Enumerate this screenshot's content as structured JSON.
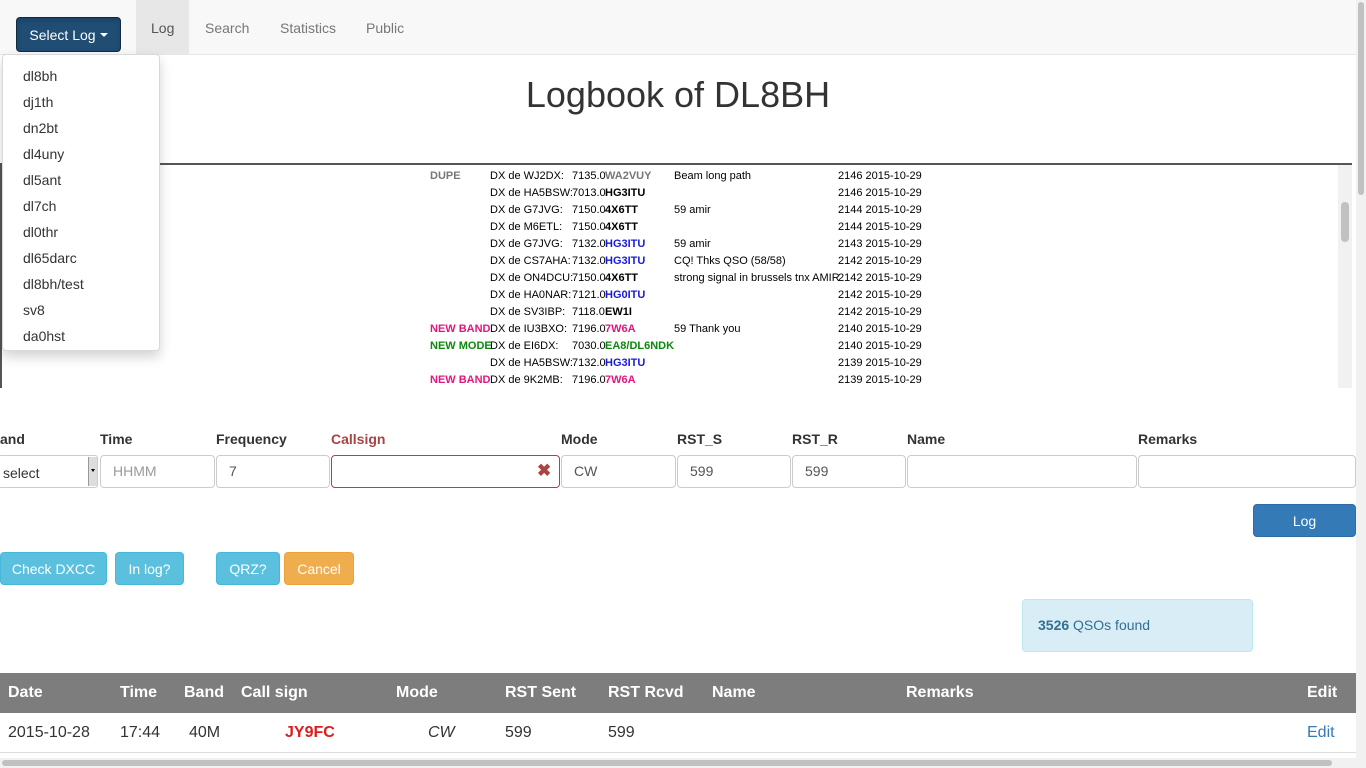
{
  "nav": {
    "select_log_label": "Select Log",
    "tabs": [
      {
        "label": "Log",
        "active": true
      },
      {
        "label": "Search",
        "active": false
      },
      {
        "label": "Statistics",
        "active": false
      },
      {
        "label": "Public",
        "active": false
      }
    ]
  },
  "dropdown": {
    "items": [
      "dl8bh",
      "dj1th",
      "dn2bt",
      "dl4uny",
      "dl5ant",
      "dl7ch",
      "dl0thr",
      "dl65darc",
      "dl8bh/test",
      "sv8",
      "da0hst"
    ]
  },
  "title": "Logbook of DL8BH",
  "cluster": {
    "rows": [
      {
        "flag": "DUPE",
        "flag_type": "dupe",
        "spotter": "DX de WJ2DX:",
        "freq": "7135.0",
        "call": "WA2VUY",
        "call_color": "#777777",
        "comment": "Beam long path",
        "time": "2146 2015-10-29"
      },
      {
        "flag": "",
        "flag_type": "",
        "spotter": "DX de HA5BSW:",
        "freq": "7013.0",
        "call": "HG3ITU",
        "call_color": "#000000",
        "comment": "",
        "time": "2146 2015-10-29"
      },
      {
        "flag": "",
        "flag_type": "",
        "spotter": "DX de G7JVG:",
        "freq": "7150.0",
        "call": "4X6TT",
        "call_color": "#000000",
        "comment": "59 amir",
        "time": "2144 2015-10-29"
      },
      {
        "flag": "",
        "flag_type": "",
        "spotter": "DX de M6ETL:",
        "freq": "7150.0",
        "call": "4X6TT",
        "call_color": "#000000",
        "comment": "",
        "time": "2144 2015-10-29"
      },
      {
        "flag": "",
        "flag_type": "",
        "spotter": "DX de G7JVG:",
        "freq": "7132.0",
        "call": "HG3ITU",
        "call_color": "#1a1ad6",
        "comment": "59 amir",
        "time": "2143 2015-10-29"
      },
      {
        "flag": "",
        "flag_type": "",
        "spotter": "DX de CS7AHA:",
        "freq": "7132.0",
        "call": "HG3ITU",
        "call_color": "#1a1ad6",
        "comment": "CQ! Thks QSO (58/58)",
        "time": "2142 2015-10-29"
      },
      {
        "flag": "",
        "flag_type": "",
        "spotter": "DX de ON4DCU:",
        "freq": "7150.0",
        "call": "4X6TT",
        "call_color": "#000000",
        "comment": "strong signal in brussels tnx AMIR",
        "time": "2142 2015-10-29"
      },
      {
        "flag": "",
        "flag_type": "",
        "spotter": "DX de HA0NAR:",
        "freq": "7121.0",
        "call": "HG0ITU",
        "call_color": "#1a1ad6",
        "comment": "",
        "time": "2142 2015-10-29"
      },
      {
        "flag": "",
        "flag_type": "",
        "spotter": "DX de SV3IBP:",
        "freq": "7118.0",
        "call": "EW1I",
        "call_color": "#000000",
        "comment": "",
        "time": "2142 2015-10-29"
      },
      {
        "flag": "NEW BAND",
        "flag_type": "newband",
        "spotter": "DX de IU3BXO:",
        "freq": "7196.0",
        "call": "7W6A",
        "call_color": "#e0177d",
        "comment": "59 Thank you",
        "time": "2140 2015-10-29"
      },
      {
        "flag": "NEW MODE",
        "flag_type": "newmode",
        "spotter": "DX de EI6DX:",
        "freq": "7030.0",
        "call": "EA8/DL6NDK",
        "call_color": "#0a8a0a",
        "comment": "",
        "time": "2140 2015-10-29"
      },
      {
        "flag": "",
        "flag_type": "",
        "spotter": "DX de HA5BSW:",
        "freq": "7132.0",
        "call": "HG3ITU",
        "call_color": "#1a1ad6",
        "comment": "",
        "time": "2139 2015-10-29"
      },
      {
        "flag": "NEW BAND",
        "flag_type": "newband",
        "spotter": "DX de 9K2MB:",
        "freq": "7196.0",
        "call": "7W6A",
        "call_color": "#e0177d",
        "comment": "",
        "time": "2139 2015-10-29"
      }
    ]
  },
  "form": {
    "labels": {
      "band": "and",
      "time": "Time",
      "frequency": "Frequency",
      "callsign": "Callsign",
      "mode": "Mode",
      "rst_s": "RST_S",
      "rst_r": "RST_R",
      "name": "Name",
      "remarks": "Remarks"
    },
    "band_value": "select",
    "time_placeholder": "HHMM",
    "frequency_value": "7",
    "callsign_value": "",
    "mode_value": "CW",
    "rst_s_value": "599",
    "rst_r_value": "599",
    "name_value": "",
    "remarks_value": ""
  },
  "buttons": {
    "log": "Log",
    "check_dxcc": "Check DXCC",
    "in_log": "In log?",
    "qrz": "QRZ?",
    "cancel": "Cancel"
  },
  "alert": {
    "count": "3526",
    "text": " QSOs found"
  },
  "table": {
    "headers": {
      "date": "Date",
      "time": "Time",
      "band": "Band",
      "callsign": "Call sign",
      "mode": "Mode",
      "rst_sent": "RST Sent",
      "rst_rcvd": "RST Rcvd",
      "name": "Name",
      "remarks": "Remarks",
      "edit": "Edit"
    },
    "rows": [
      {
        "date": "2015-10-28",
        "time": "17:44",
        "band": "40M",
        "callsign": "JY9FC",
        "mode": "CW",
        "rst_sent": "599",
        "rst_rcvd": "599",
        "name": "",
        "remarks": "",
        "edit": "Edit"
      }
    ]
  },
  "colors": {
    "navy_button": "#204d74",
    "info": "#5bc0de",
    "warning": "#f0ad4e",
    "primary": "#337ab7",
    "error": "#a94442"
  }
}
